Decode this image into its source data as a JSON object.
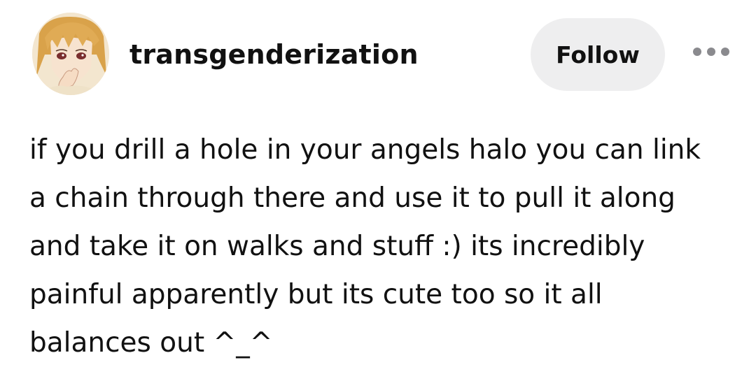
{
  "post": {
    "author": {
      "username": "transgenderization",
      "avatar_icon": "anime-avatar"
    },
    "follow_label": "Follow",
    "more_icon": "more-horizontal-icon",
    "body_lines": [
      "if you drill a hole in your angels halo you can link",
      "a chain through there and use it to pull it along",
      "and take it on walks and stuff :) its incredibly",
      "painful apparently but its cute too so it all",
      "balances out ^_^"
    ]
  },
  "colors": {
    "text": "#111111",
    "follow_bg": "#eeeeef",
    "more_dots": "#8a8a8e",
    "background": "#ffffff"
  }
}
